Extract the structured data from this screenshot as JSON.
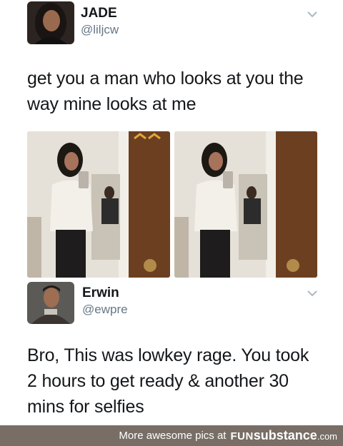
{
  "tweets": [
    {
      "name": "JADE",
      "handle": "@liljcw",
      "text_lines": [
        "get you a man who looks at you the",
        "way mine looks at me"
      ]
    },
    {
      "name": "Erwin",
      "handle": "@ewpre",
      "text_lines": [
        "Bro, This was lowkey rage. You took",
        "2 hours to get ready & another 30",
        "mins for selfies"
      ]
    }
  ],
  "footer": {
    "text": "More awesome pics at",
    "brand_fun": "FUN",
    "brand_sub": "substance",
    "brand_com": ".com"
  },
  "colors": {
    "handle": "#657786",
    "footer_bg": "#786e66"
  },
  "icons": {
    "chevron": "chevron-down-icon"
  }
}
